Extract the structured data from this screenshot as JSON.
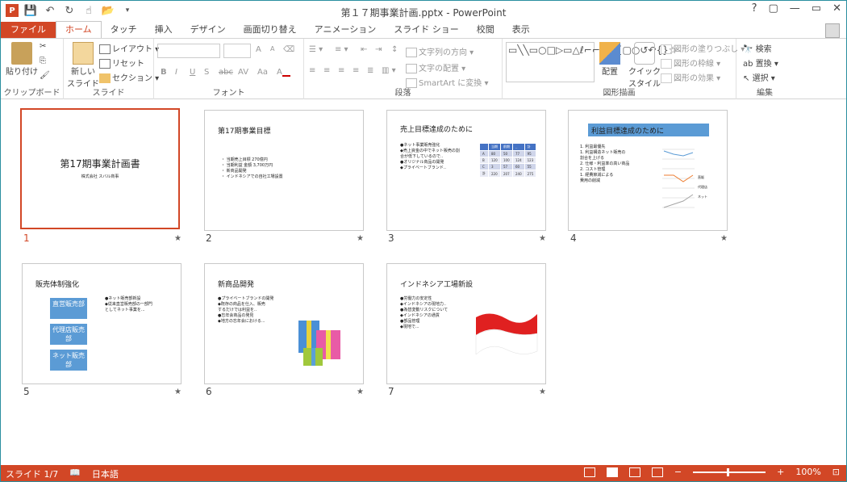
{
  "app": {
    "title": "第１７期事業計画.pptx - PowerPoint",
    "help": "?",
    "restore": "▢",
    "minimize": "—",
    "maximize": "▭",
    "close": "✕"
  },
  "tabs": [
    "ファイル",
    "ホーム",
    "タッチ",
    "挿入",
    "デザイン",
    "画面切り替え",
    "アニメーション",
    "スライド ショー",
    "校閲",
    "表示"
  ],
  "ribbon": {
    "clipboard": {
      "paste": "貼り付け",
      "label": "クリップボード"
    },
    "slides": {
      "new_slide": "新しい",
      "new_slide2": "スライド",
      "layout": "レイアウト",
      "reset": "リセット",
      "section": "セクション",
      "label": "スライド"
    },
    "font": {
      "label": "フォント",
      "bold": "B",
      "italic": "I",
      "underline": "U",
      "shadow": "S",
      "strike": "abc",
      "spacing": "AV",
      "case": "Aa",
      "grow": "A",
      "shrink": "A"
    },
    "paragraph": {
      "label": "段落",
      "text_direction": "文字列の方向",
      "align_text": "文字の配置",
      "smartart": "SmartArt に変換"
    },
    "drawing": {
      "label": "図形描画",
      "arrange": "配置",
      "quick_styles": "クイック",
      "quick_styles2": "スタイル",
      "fill": "図形の塗りつぶし",
      "outline": "図形の枠線",
      "effects": "図形の効果"
    },
    "editing": {
      "label": "編集",
      "find": "検索",
      "replace": "置換",
      "select": "選択"
    }
  },
  "slides": [
    {
      "num": "1",
      "title": "第17期事業計画書",
      "subtitle": "株式会社 スバル商事"
    },
    {
      "num": "2",
      "title": "第17期事業目標",
      "body": "・ 当期売上目標  270億円\n・ 当期利益  金額 3,700万円\n・ 新商品開発\n・ インドネシアでの自社工場設置"
    },
    {
      "num": "3",
      "title": "売上目標達成のために",
      "body": "●ネット事業販売強化\n  ◆売上資金の中でネット販売の割\n   合が低下しているので..\n●オリジナル商品の開発\n  ◆プライベートブランド..",
      "table": [
        [
          "",
          "当期",
          "前期",
          "..",
          "計"
        ],
        [
          "A",
          "80",
          "50",
          "77",
          "95"
        ],
        [
          "B",
          "120",
          "100",
          "124",
          "123"
        ],
        [
          "C",
          "3",
          "57",
          "60",
          "55"
        ],
        [
          "計",
          "220",
          "207",
          "240",
          "275"
        ]
      ]
    },
    {
      "num": "4",
      "title": "利益目標達成のために",
      "body": "1. 利益最優先\n  1. 利益構造ネット販売の\n     割合を上げる\n  2. 仕様・利益率の高い商品\n2. コスト管理\n  1. 経費節減による\n     費用の削減",
      "legend": [
        "直販",
        "代理店",
        "ネット"
      ]
    },
    {
      "num": "5",
      "title": "販売体制強化",
      "boxes": [
        "直営販売部",
        "代理店販売部",
        "ネット販売部"
      ],
      "body": "●ネット販売部新設\n  ◆従来直営販売部の一部門\n   としてネット事業を..."
    },
    {
      "num": "6",
      "title": "新商品開発",
      "body": "●プライベートブランドの開発\n  ◆既存の商品を仕入、販売\n   するだけでは利益を..\n●忘年会商品の発見\n  ◆地方の忘年会における..."
    },
    {
      "num": "7",
      "title": "インドネシア工場新設",
      "body": "●労働力の安定性\n  ◆インドネシアの現地力..\n●為替変動リスクについて\n  ◆インドネシアの通貨\n●部品管理\n  ◆現地で..."
    }
  ],
  "status": {
    "slide": "スライド 1/7",
    "language": "日本語",
    "zoom": "100%",
    "minus": "−",
    "plus": "+"
  }
}
